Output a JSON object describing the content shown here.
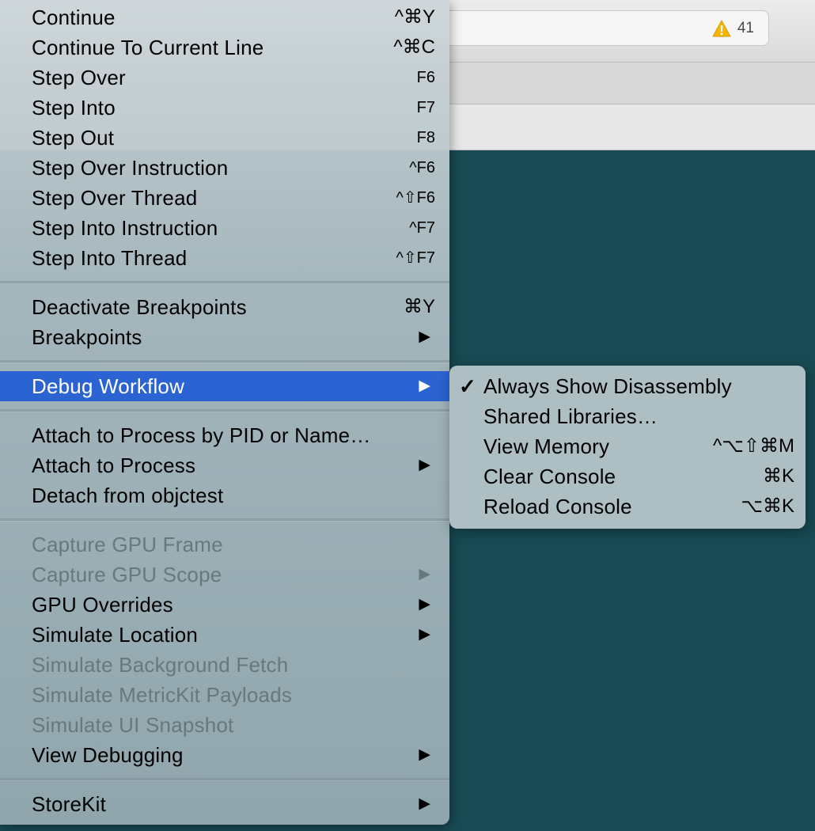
{
  "toolbar": {
    "warning_count": "41"
  },
  "debug_menu": {
    "groups": [
      [
        {
          "label": "Continue",
          "shortcut": "^⌘Y"
        },
        {
          "label": "Continue To Current Line",
          "shortcut": "^⌘C"
        },
        {
          "label": "Step Over",
          "shortcut": "F6"
        },
        {
          "label": "Step Into",
          "shortcut": "F7"
        },
        {
          "label": "Step Out",
          "shortcut": "F8"
        },
        {
          "label": "Step Over Instruction",
          "shortcut": "^F6"
        },
        {
          "label": "Step Over Thread",
          "shortcut": "^⇧F6"
        },
        {
          "label": "Step Into Instruction",
          "shortcut": "^F7"
        },
        {
          "label": "Step Into Thread",
          "shortcut": "^⇧F7"
        }
      ],
      [
        {
          "label": "Deactivate Breakpoints",
          "shortcut": "⌘Y"
        },
        {
          "label": "Breakpoints",
          "arrow": "▶"
        }
      ],
      [
        {
          "label": "Debug Workflow",
          "arrow": "▶"
        }
      ],
      [
        {
          "label": "Attach to Process by PID or Name…"
        },
        {
          "label": "Attach to Process",
          "arrow": "▶"
        },
        {
          "label": "Detach from objctest"
        }
      ],
      [
        {
          "label": "Capture GPU Frame"
        },
        {
          "label": "Capture GPU Scope",
          "arrow": "▶"
        },
        {
          "label": "GPU Overrides",
          "arrow": "▶"
        },
        {
          "label": "Simulate Location",
          "arrow": "▶"
        },
        {
          "label": "Simulate Background Fetch"
        },
        {
          "label": "Simulate MetricKit Payloads"
        },
        {
          "label": "Simulate UI Snapshot"
        },
        {
          "label": "View Debugging",
          "arrow": "▶"
        }
      ],
      [
        {
          "label": "StoreKit",
          "arrow": "▶"
        }
      ]
    ]
  },
  "debug_workflow_submenu": {
    "items": [
      {
        "label": "Always Show Disassembly",
        "check": "✓"
      },
      {
        "label": "Shared Libraries…"
      },
      {
        "label": "View Memory",
        "shortcut": "^⌥⇧⌘M"
      },
      {
        "label": "Clear Console",
        "shortcut": "⌘K"
      },
      {
        "label": "Reload Console",
        "shortcut": "⌥⌘K"
      }
    ]
  },
  "colors": {
    "highlight": "#2b63d2",
    "editor_background": "#184a54",
    "disabled_text": "#65797f",
    "warning": "#f4b400"
  }
}
